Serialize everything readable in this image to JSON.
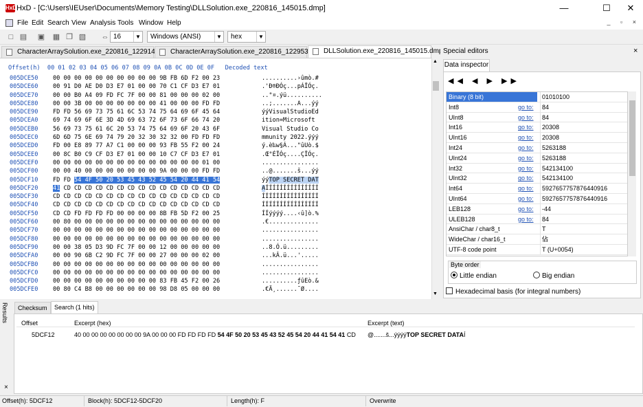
{
  "window": {
    "app": "HxD",
    "title": "HxD - [C:\\Users\\IEUser\\Documents\\Memory Testing\\DLLSolution.exe_220816_145015.dmp]",
    "minimize": "—",
    "maximize": "☐",
    "close": "✕"
  },
  "menu": [
    "File",
    "Edit",
    "Search",
    "View",
    "Analysis",
    "Tools",
    "Window",
    "Help"
  ],
  "mdi_controls": "_ ▫ ×",
  "toolbar": {
    "columns_value": "16",
    "charset_value": "Windows (ANSI)",
    "display_value": "hex"
  },
  "tabs": [
    {
      "label": "CharacterArraySolution.exe_220816_122914.dmp"
    },
    {
      "label": "CharacterArraySolution.exe_220816_122953.dmp"
    },
    {
      "label": "DLLSolution.exe_220816_145015.dmp"
    }
  ],
  "hex_header": "Offset(h)  00 01 02 03 04 05 06 07 08 09 0A 0B 0C 0D 0E 0F   Decoded text",
  "hex_rows": [
    {
      "offset": "005DCE50",
      "hex": "00 00 00 00 00 00 00 00 00 00 9B FB 6D F2 00 23",
      "ascii": "..........›ûmò.#"
    },
    {
      "offset": "005DCE60",
      "hex": "00 91 D0 AE D0 D3 E7 01 00 00 70 C1 CF D3 E7 01",
      "ascii": ".'Ð®ÐÓç...pÁÏÓç."
    },
    {
      "offset": "005DCE70",
      "hex": "00 00 B0 A4 09 FD FC 7F 00 00 81 00 00 00 02 00",
      "ascii": "..°¤.ýü.........."
    },
    {
      "offset": "005DCE80",
      "hex": "00 00 3B 00 00 00 00 00 00 00 41 00 00 00 FD FD",
      "ascii": "..;.......A...ýý"
    },
    {
      "offset": "005DCE90",
      "hex": "FD FD 56 69 73 75 61 6C 53 74 75 64 69 6F 45 64",
      "ascii": "ýýVisualStudioEd"
    },
    {
      "offset": "005DCEA0",
      "hex": "69 74 69 6F 6E 3D 4D 69 63 72 6F 73 6F 66 74 20",
      "ascii": "ition=Microsoft "
    },
    {
      "offset": "005DCEB0",
      "hex": "56 69 73 75 61 6C 20 53 74 75 64 69 6F 20 43 6F",
      "ascii": "Visual Studio Co"
    },
    {
      "offset": "005DCEC0",
      "hex": "6D 6D 75 6E 69 74 79 20 32 30 32 32 00 FD FD FD",
      "ascii": "mmunity 2022.ýýý"
    },
    {
      "offset": "005DCED0",
      "hex": "FD 00 E8 89 77 A7 C1 00 00 00 93 FB 55 F2 00 24",
      "ascii": "ý.è‰w§Á...\"ûUò.$"
    },
    {
      "offset": "005DCEE0",
      "hex": "00 8C B0 C9 CF D3 E7 01 00 00 10 C7 CF D3 E7 01",
      "ascii": ".Œ°ÉÏÓç....ÇÏÓç."
    },
    {
      "offset": "005DCEF0",
      "hex": "00 00 00 00 00 00 00 00 00 00 00 00 00 00 01 00",
      "ascii": "................"
    },
    {
      "offset": "005DCF00",
      "hex": "00 00 40 00 00 00 00 00 00 00 9A 00 00 00 FD FD",
      "ascii": "..@.......š...ýý"
    },
    {
      "offset": "005DCF10",
      "hex": "FD FD 54 4F 50 20 53 45 43 52 45 54 20 44 41 54",
      "ascii": "ýýTOP SECRET DAT"
    },
    {
      "offset": "005DCF20",
      "hex": "41 CD CD CD CD CD CD CD CD CD CD CD CD CD CD CD",
      "ascii": "AÍÍÍÍÍÍÍÍÍÍÍÍÍÍÍ"
    },
    {
      "offset": "005DCF30",
      "hex": "CD CD CD CD CD CD CD CD CD CD CD CD CD CD CD CD",
      "ascii": "ÍÍÍÍÍÍÍÍÍÍÍÍÍÍÍÍ"
    },
    {
      "offset": "005DCF40",
      "hex": "CD CD CD CD CD CD CD CD CD CD CD CD CD CD CD CD",
      "ascii": "ÍÍÍÍÍÍÍÍÍÍÍÍÍÍÍÍ"
    },
    {
      "offset": "005DCF50",
      "hex": "CD CD FD FD FD FD 00 00 00 00 8B FB 5D F2 00 25",
      "ascii": "ÍÍýýýý....‹û]ò.%"
    },
    {
      "offset": "005DCF60",
      "hex": "00 80 00 00 00 00 00 00 00 00 00 00 00 00 00 00",
      "ascii": ".€.............."
    },
    {
      "offset": "005DCF70",
      "hex": "00 00 00 00 00 00 00 00 00 00 00 00 00 00 00 00",
      "ascii": "................"
    },
    {
      "offset": "005DCF80",
      "hex": "00 00 00 00 00 00 00 00 00 00 00 00 00 00 00 00",
      "ascii": "................"
    },
    {
      "offset": "005DCF90",
      "hex": "00 00 38 05 D3 9D FC 7F 00 00 12 00 00 00 00 00",
      "ascii": "..8.Ó.ü........."
    },
    {
      "offset": "005DCFA0",
      "hex": "00 00 90 6B C2 9D FC 7F 00 00 27 00 00 00 02 00",
      "ascii": "...kÂ.ü...'....."
    },
    {
      "offset": "005DCFB0",
      "hex": "00 00 00 00 00 00 00 00 00 00 00 00 00 00 00 00",
      "ascii": "................"
    },
    {
      "offset": "005DCFC0",
      "hex": "00 00 00 00 00 00 00 00 00 00 00 00 00 00 00 00",
      "ascii": "................"
    },
    {
      "offset": "005DCFD0",
      "hex": "00 00 00 00 00 00 00 00 00 00 83 FB 45 F2 00 26",
      "ascii": "..........ƒûEò.&"
    },
    {
      "offset": "005DCFE0",
      "hex": "00 80 C4 B8 00 00 00 00 00 00 98 D8 05 00 00 00",
      "ascii": ".€Ä¸......˜Ø...."
    }
  ],
  "special_editors": {
    "title": "Special editors",
    "close": "×",
    "tab": "Data inspector",
    "nav": "◀◀ ◀ ▶ ▶▶",
    "goto_label": "go to:",
    "rows": [
      {
        "name": "Binary (8 bit)",
        "goto": "",
        "value": "01010100"
      },
      {
        "name": "Int8",
        "goto": "go to:",
        "value": "84"
      },
      {
        "name": "UInt8",
        "goto": "go to:",
        "value": "84"
      },
      {
        "name": "Int16",
        "goto": "go to:",
        "value": "20308"
      },
      {
        "name": "UInt16",
        "goto": "go to:",
        "value": "20308"
      },
      {
        "name": "Int24",
        "goto": "go to:",
        "value": "5263188"
      },
      {
        "name": "UInt24",
        "goto": "go to:",
        "value": "5263188"
      },
      {
        "name": "Int32",
        "goto": "go to:",
        "value": "542134100"
      },
      {
        "name": "UInt32",
        "goto": "go to:",
        "value": "542134100"
      },
      {
        "name": "Int64",
        "goto": "go to:",
        "value": "5927657757876440916"
      },
      {
        "name": "UInt64",
        "goto": "go to:",
        "value": "5927657757876440916"
      },
      {
        "name": "LEB128",
        "goto": "go to:",
        "value": "-44"
      },
      {
        "name": "ULEB128",
        "goto": "go to:",
        "value": "84"
      },
      {
        "name": "AnsiChar / char8_t",
        "goto": "",
        "value": "T"
      },
      {
        "name": "WideChar / char16_t",
        "goto": "",
        "value": "佔"
      },
      {
        "name": "UTF-8 code point",
        "goto": "",
        "value": "T (U+0054)"
      }
    ],
    "byte_order_title": "Byte order",
    "little_endian": "Little endian",
    "big_endian": "Big endian",
    "hex_basis": "Hexadecimal basis (for integral numbers)"
  },
  "results": {
    "side_label": "Results",
    "close": "×",
    "tabs": [
      "Checksum",
      "Search (1 hits)"
    ],
    "headers": {
      "offset": "Offset",
      "excerpt_hex": "Excerpt (hex)",
      "excerpt_text": "Excerpt (text)"
    },
    "row": {
      "offset": "5DCF12",
      "hex_plain": "40 00 00 00 00 00 00 00 9A 00 00 00 FD FD FD FD ",
      "hex_bold": "54 4F 50 20 53 45 43 52 45 54 20 44 41 54 41",
      "hex_tail": " CD",
      "text_plain": "@.......š...ýýýý",
      "text_bold": "TOP SECRET DATA",
      "text_tail": "Í"
    }
  },
  "status": {
    "offset": "Offset(h): 5DCF12",
    "block": "Block(h): 5DCF12-5DCF20",
    "length": "Length(h): F",
    "mode": "Overwrite"
  }
}
